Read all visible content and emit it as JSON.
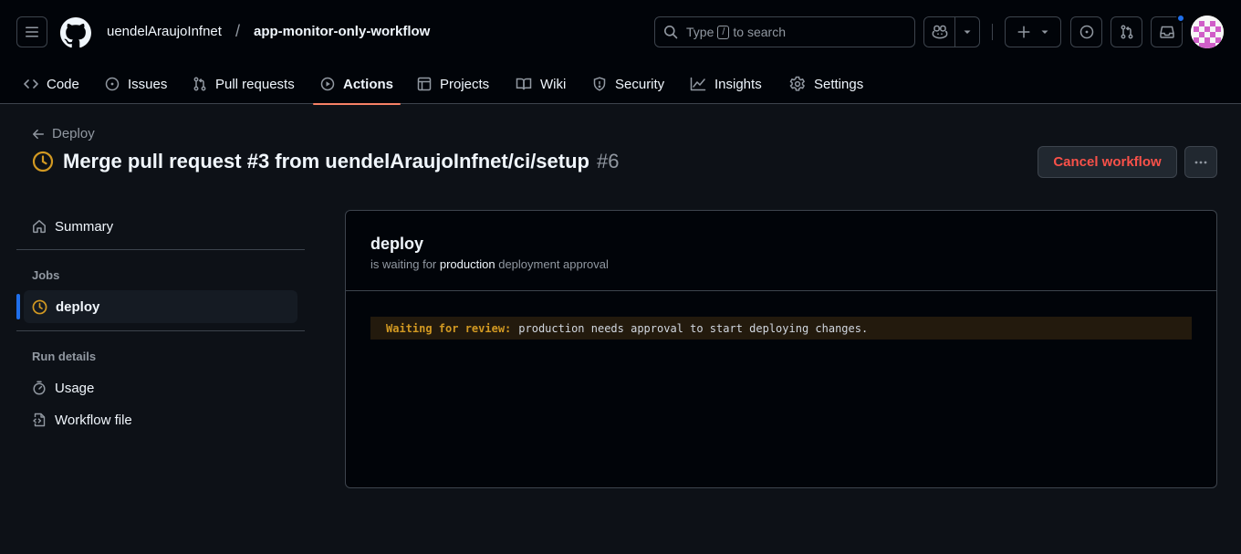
{
  "header": {
    "owner": "uendelAraujoInfnet",
    "separator": "/",
    "repo": "app-monitor-only-workflow",
    "search": {
      "prefix": "Type",
      "key": "/",
      "suffix": "to search"
    }
  },
  "tabs": [
    {
      "label": "Code",
      "icon": "code-icon"
    },
    {
      "label": "Issues",
      "icon": "issue-opened-icon"
    },
    {
      "label": "Pull requests",
      "icon": "git-pull-request-icon"
    },
    {
      "label": "Actions",
      "icon": "play-icon",
      "selected": true
    },
    {
      "label": "Projects",
      "icon": "table-icon"
    },
    {
      "label": "Wiki",
      "icon": "book-icon"
    },
    {
      "label": "Security",
      "icon": "shield-icon"
    },
    {
      "label": "Insights",
      "icon": "graph-icon"
    },
    {
      "label": "Settings",
      "icon": "gear-icon"
    }
  ],
  "run": {
    "back_label": "Deploy",
    "title": "Merge pull request #3 from uendelAraujoInfnet/ci/setup",
    "number": "#6",
    "status": "waiting",
    "cancel_label": "Cancel workflow"
  },
  "sidebar": {
    "summary_label": "Summary",
    "jobs_heading": "Jobs",
    "job_label": "deploy",
    "run_details_heading": "Run details",
    "usage_label": "Usage",
    "workflow_file_label": "Workflow file"
  },
  "job": {
    "name": "deploy",
    "status_prefix": "is waiting for",
    "environment": "production",
    "status_suffix": "deployment approval",
    "review_label": "Waiting for review:",
    "review_message": "production needs approval to start deploying changes."
  },
  "colors": {
    "background": "#0d1117",
    "header_background": "#010409",
    "selected_tab_underline": "#f78166",
    "waiting_status": "#d29922",
    "danger": "#f85149",
    "accent": "#1f6feb"
  }
}
